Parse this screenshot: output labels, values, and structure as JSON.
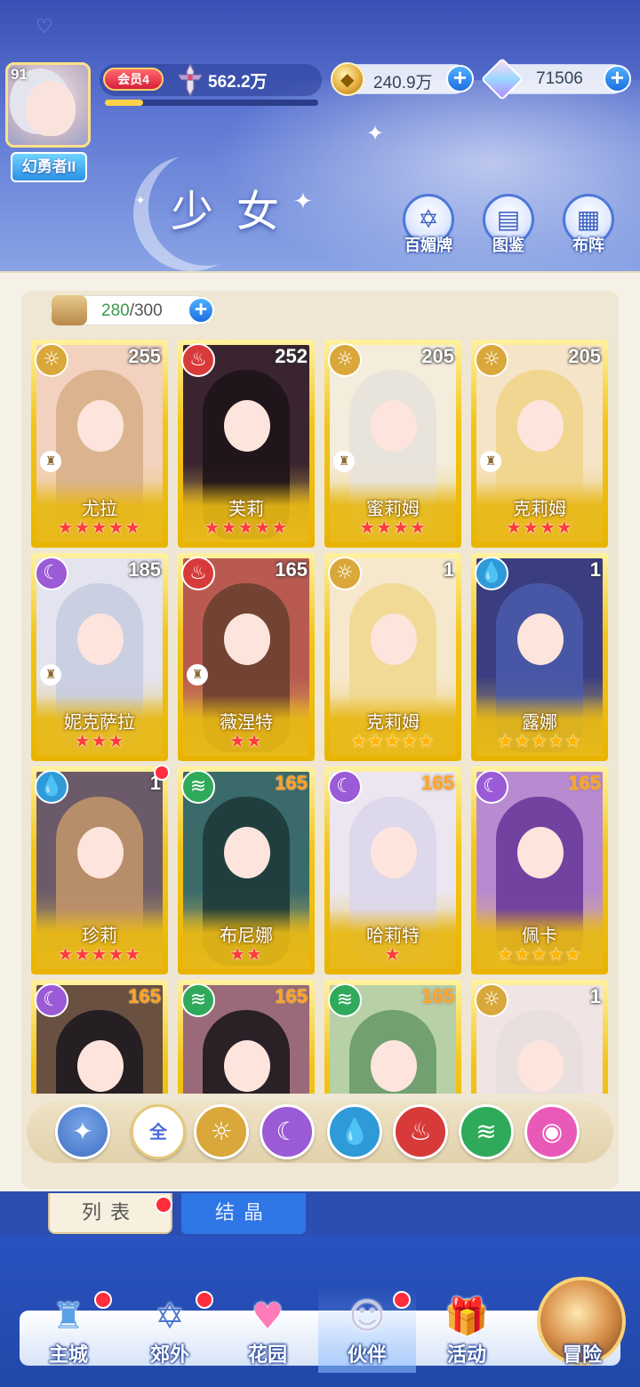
{
  "header": {
    "player_level": "91",
    "player_title": "幻勇者II",
    "vip_label": "会员4",
    "power": "562.2万",
    "exp_progress": 0.18,
    "gold": "240.9万",
    "gems": "71506",
    "page_title": "少女",
    "buttons": [
      {
        "label": "百媚牌",
        "icon": "hexagram-card-icon"
      },
      {
        "label": "图鉴",
        "icon": "book-icon"
      },
      {
        "label": "布阵",
        "icon": "grid-formation-icon"
      }
    ]
  },
  "capacity": {
    "current": "280",
    "max": "/300"
  },
  "elements": {
    "sun": {
      "icon": "sun-element-icon",
      "color": "#d9a73a",
      "glyph": "☼"
    },
    "moon": {
      "icon": "moon-element-icon",
      "color": "#9b5ad6",
      "glyph": "☾"
    },
    "water": {
      "icon": "water-element-icon",
      "color": "#2f9ad8",
      "glyph": "💧"
    },
    "fire": {
      "icon": "fire-element-icon",
      "color": "#d83a3a",
      "glyph": "♨"
    },
    "wind": {
      "icon": "wind-element-icon",
      "color": "#2faa5a",
      "glyph": "≋"
    },
    "heart": {
      "icon": "pink-element-icon",
      "color": "#e85ab8",
      "glyph": "◉"
    }
  },
  "cards": [
    {
      "name": "尤拉",
      "level": "255",
      "element": "sun",
      "stars": "★★★★★",
      "star_color": "red",
      "level_color": "white",
      "art": "#f2d2bf",
      "hair": "#d8b08a",
      "role": true,
      "dot": false
    },
    {
      "name": "芙莉",
      "level": "252",
      "element": "fire",
      "stars": "★★★★★",
      "star_color": "red",
      "level_color": "white",
      "art": "#3a2430",
      "hair": "#1e1418",
      "role": false,
      "dot": false
    },
    {
      "name": "蜜莉姆",
      "level": "205",
      "element": "sun",
      "stars": "★★★★",
      "star_color": "red",
      "level_color": "white",
      "art": "#f4eddc",
      "hair": "#e8e2da",
      "role": true,
      "dot": false
    },
    {
      "name": "克莉姆",
      "level": "205",
      "element": "sun",
      "stars": "★★★★",
      "star_color": "red",
      "level_color": "white",
      "art": "#f6e4c8",
      "hair": "#f0d48a",
      "role": true,
      "dot": false
    },
    {
      "name": "妮克萨拉",
      "level": "185",
      "element": "moon",
      "stars": "★★★",
      "star_color": "red",
      "level_color": "white",
      "art": "#e4e4f0",
      "hair": "#c8cce0",
      "role": true,
      "dot": false
    },
    {
      "name": "薇涅特",
      "level": "165",
      "element": "fire",
      "stars": "★★",
      "star_color": "red",
      "level_color": "white",
      "art": "#b85a50",
      "hair": "#6a4030",
      "role": true,
      "dot": false
    },
    {
      "name": "克莉姆",
      "level": "1",
      "element": "sun",
      "stars": "★★★★★",
      "star_color": "gold",
      "level_color": "white",
      "art": "#f6e8cc",
      "hair": "#f0d890",
      "role": false,
      "dot": false
    },
    {
      "name": "露娜",
      "level": "1",
      "element": "water",
      "stars": "★★★★★",
      "star_color": "gold",
      "level_color": "white",
      "art": "#3a3e80",
      "hair": "#4a5aa8",
      "role": false,
      "dot": false
    },
    {
      "name": "珍莉",
      "level": "1",
      "element": "water",
      "stars": "★★★★★",
      "star_color": "red",
      "level_color": "white",
      "art": "#6a5a6a",
      "hair": "#c0946a",
      "role": false,
      "dot": true
    },
    {
      "name": "布尼娜",
      "level": "165",
      "element": "wind",
      "stars": "★★",
      "star_color": "red",
      "level_color": "orange",
      "art": "#3a6a6a",
      "hair": "#1e3a3a",
      "role": false,
      "dot": false
    },
    {
      "name": "哈莉特",
      "level": "165",
      "element": "moon",
      "stars": "★",
      "star_color": "red",
      "level_color": "orange",
      "art": "#ece6f0",
      "hair": "#dcd6ea",
      "role": false,
      "dot": false
    },
    {
      "name": "佩卡",
      "level": "165",
      "element": "moon",
      "stars": "★★★★★",
      "star_color": "gold",
      "level_color": "orange",
      "art": "#b88ad0",
      "hair": "#6a3a9a",
      "role": false,
      "dot": false
    },
    {
      "name": "",
      "level": "165",
      "element": "moon",
      "stars": "",
      "star_color": "red",
      "level_color": "orange",
      "art": "#6a5040",
      "hair": "#1e1a20",
      "role": false,
      "dot": false
    },
    {
      "name": "",
      "level": "165",
      "element": "wind",
      "stars": "",
      "star_color": "red",
      "level_color": "orange",
      "art": "#9a6a78",
      "hair": "#1e1a1e",
      "role": false,
      "dot": false
    },
    {
      "name": "",
      "level": "165",
      "element": "wind",
      "stars": "",
      "star_color": "red",
      "level_color": "orange",
      "art": "#b8d0a8",
      "hair": "#6a9a6a",
      "role": false,
      "dot": false
    },
    {
      "name": "",
      "level": "1",
      "element": "sun",
      "stars": "",
      "star_color": "red",
      "level_color": "white",
      "art": "#f0e4e4",
      "hair": "#e8dede",
      "role": false,
      "dot": false
    }
  ],
  "filters": [
    {
      "label": "",
      "icon": "sparkle-filter-icon",
      "color": "#3f6fc4",
      "glyph": "✦"
    },
    {
      "label": "全",
      "icon": "all-filter-icon",
      "color": "#ffffff",
      "glyph": ""
    },
    {
      "label": "",
      "icon": "sun-element-icon",
      "color": "#d9a73a",
      "glyph": "☼"
    },
    {
      "label": "",
      "icon": "moon-element-icon",
      "color": "#9b5ad6",
      "glyph": "☾"
    },
    {
      "label": "",
      "icon": "water-element-icon",
      "color": "#2f9ad8",
      "glyph": "💧"
    },
    {
      "label": "",
      "icon": "fire-element-icon",
      "color": "#d83a3a",
      "glyph": "♨"
    },
    {
      "label": "",
      "icon": "wind-element-icon",
      "color": "#2faa5a",
      "glyph": "≋"
    },
    {
      "label": "",
      "icon": "pink-element-icon",
      "color": "#e85ab8",
      "glyph": "◉"
    }
  ],
  "tabs": {
    "list": "列表",
    "crystal": "结晶"
  },
  "nav": [
    {
      "label": "主城",
      "icon": "castle-icon",
      "glyph": "♜",
      "color": "#5aa0e8",
      "dot": true,
      "active": false
    },
    {
      "label": "郊外",
      "icon": "outskirts-icon",
      "glyph": "✡",
      "color": "#4a78d0",
      "dot": true,
      "active": false
    },
    {
      "label": "花园",
      "icon": "heart-garden-icon",
      "glyph": "♥",
      "color": "#ff7ab8",
      "dot": false,
      "active": false
    },
    {
      "label": "伙伴",
      "icon": "partner-avatar-icon",
      "glyph": "☺",
      "color": "#c8c8e0",
      "dot": true,
      "active": true
    },
    {
      "label": "活动",
      "icon": "gift-box-icon",
      "glyph": "🎁",
      "color": "#ff7a9a",
      "dot": false,
      "active": false
    },
    {
      "label": "冒险",
      "icon": "adventure-icon",
      "glyph": "",
      "color": "#d8904a",
      "dot": false,
      "active": false
    }
  ]
}
